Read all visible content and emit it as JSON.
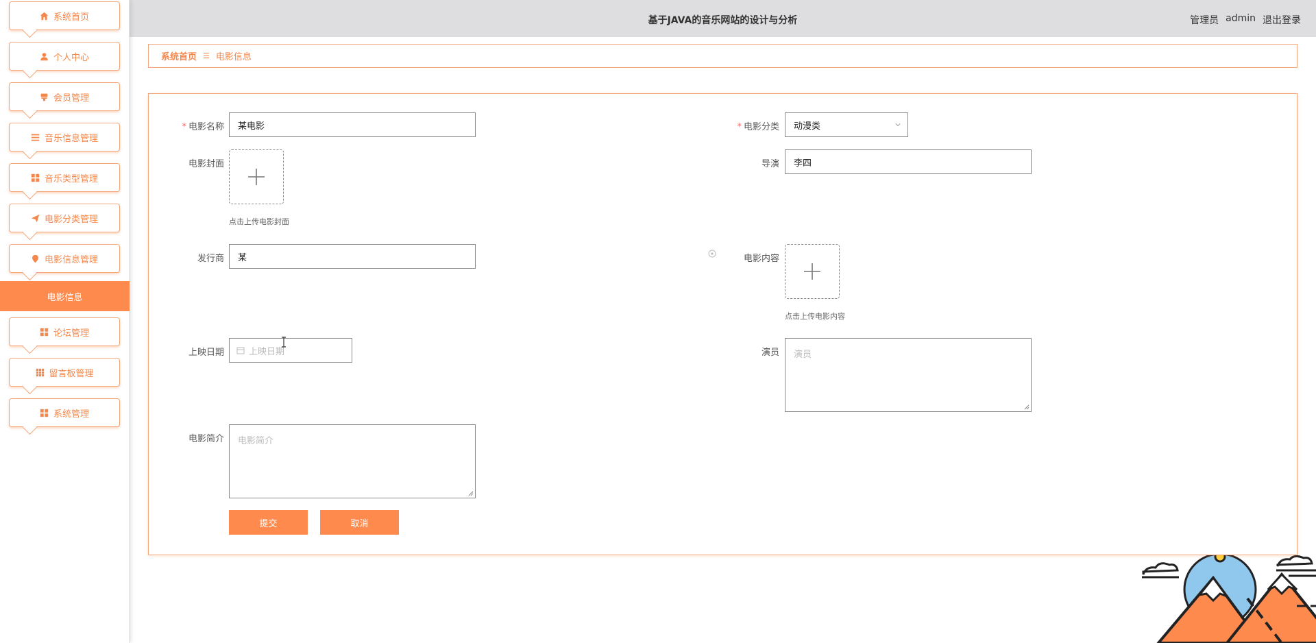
{
  "sidebar": {
    "items": [
      {
        "label": "系统首页",
        "icon": "home-icon"
      },
      {
        "label": "个人中心",
        "icon": "user-icon"
      },
      {
        "label": "会员管理",
        "icon": "stamp-icon"
      },
      {
        "label": "音乐信息管理",
        "icon": "list-icon"
      },
      {
        "label": "音乐类型管理",
        "icon": "grid-icon"
      },
      {
        "label": "电影分类管理",
        "icon": "send-icon"
      },
      {
        "label": "电影信息管理",
        "icon": "pin-icon"
      },
      {
        "label": "论坛管理",
        "icon": "grid-icon"
      },
      {
        "label": "留言板管理",
        "icon": "apps-icon"
      },
      {
        "label": "系统管理",
        "icon": "grid-icon"
      }
    ],
    "active_sub": "电影信息"
  },
  "header": {
    "title": "基于JAVA的音乐网站的设计与分析",
    "role": "管理员",
    "user": "admin",
    "logout": "退出登录"
  },
  "breadcrumb": {
    "home": "系统首页",
    "current": "电影信息"
  },
  "form": {
    "name_label": "电影名称",
    "name_value": "某电影",
    "category_label": "电影分类",
    "category_value": "动漫类",
    "cover_label": "电影封面",
    "cover_hint": "点击上传电影封面",
    "director_label": "导演",
    "director_value": "李四",
    "publisher_label": "发行商",
    "publisher_value": "某",
    "content_label": "电影内容",
    "content_hint": "点击上传电影内容",
    "date_label": "上映日期",
    "date_placeholder": "上映日期",
    "actors_label": "演员",
    "actors_placeholder": "演员",
    "intro_label": "电影简介",
    "intro_placeholder": "电影简介",
    "submit": "提交",
    "cancel": "取消"
  },
  "colors": {
    "accent": "#ff8a4e",
    "accent_border": "#f4a77a",
    "header_bg": "#dedddf",
    "required": "#f56c6c"
  }
}
